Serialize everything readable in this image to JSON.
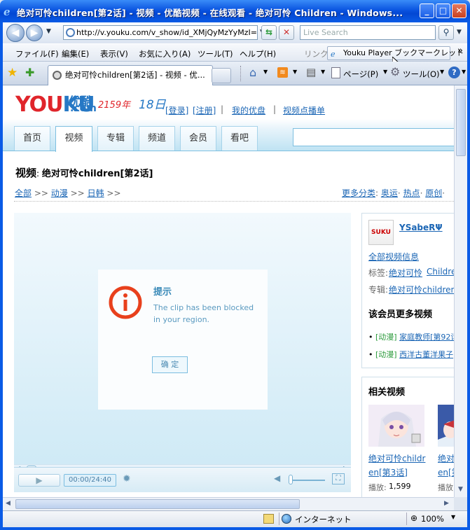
{
  "window": {
    "title": "绝对可怜children[第2话] - 视频 - 优酷视频 - 在线观看 - 绝对可怜 Children - Windows...",
    "buttons": {
      "minimize": "_",
      "maximize": "□",
      "close": "✕"
    }
  },
  "address_bar": {
    "url": "http://v.youku.com/v_show/id_XMjQyMzYyMzI=",
    "search_placeholder": "Live Search"
  },
  "menu": {
    "items": [
      "ファイル(F)",
      "編集(E)",
      "表示(V)",
      "お気に入り(A)",
      "ツール(T)",
      "ヘルプ(H)"
    ],
    "links_label": "リンク",
    "link_button": "Youku Player ブックマークレット",
    "more": "»"
  },
  "tabbar": {
    "tab_title": "绝对可怜children[第2话] - 视频 - 优...",
    "page_label": "ページ(P)",
    "tools_label": "ツール(O)"
  },
  "page": {
    "logo_you": "YOU",
    "logo_ku": "KU",
    "logo_cn": "优酷",
    "logo_com": ".com",
    "date_text": "2159年",
    "date_day": "18日",
    "login": "[登录]",
    "register": "[注册]",
    "sep": "|",
    "my_youku": "我的优盘",
    "playlist": "视频点播单",
    "nav_tabs": [
      "首页",
      "视频",
      "专辑",
      "频道",
      "会员",
      "看吧"
    ],
    "heading_prefix": "视频",
    "heading_title": "绝对可怜children[第2话]",
    "breadcrumb": [
      "全部",
      "动漫",
      "日韩"
    ],
    "breadcrumb_sep": ">>",
    "more_categories": "更多分类",
    "cat_links": [
      "奥运",
      "热点",
      "原创"
    ],
    "dialog": {
      "title": "提示",
      "message_line1": "The clip has been blocked",
      "message_line2": "in your region.",
      "ok": "确 定"
    },
    "player": {
      "time": "00:00/24:40",
      "progress": 0.0
    },
    "uploader": {
      "avatar_text": "SUKU",
      "name": "YSabeRΨ",
      "all_info": "全部视频信息",
      "tags_label": "标签:",
      "tags_value": "绝对可怜",
      "tags_value2": "Childre",
      "album_label": "专辑:",
      "album_value": "绝对可怜children"
    },
    "member_more": {
      "title": "该会员更多视频",
      "items": [
        {
          "cat": "[动漫]",
          "title": "家庭教师[第92话"
        },
        {
          "cat": "[动漫]",
          "title": "西洋古董洋果子"
        }
      ]
    },
    "related": {
      "title": "相关视频",
      "video_title_1": "绝对可怜childr",
      "video_title_2": "en[第3话]",
      "video_title_3": "绝对",
      "video_title_4": "en[第",
      "plays_label": "播放:",
      "plays_value": "1,599",
      "plays_label2": "播放"
    }
  },
  "status": {
    "zone": "インターネット",
    "zoom": "100%"
  },
  "colors": {
    "accent": "#2678c5",
    "brand_red": "#e0252b",
    "link": "#1b66b5",
    "green": "#2a9a3a"
  }
}
